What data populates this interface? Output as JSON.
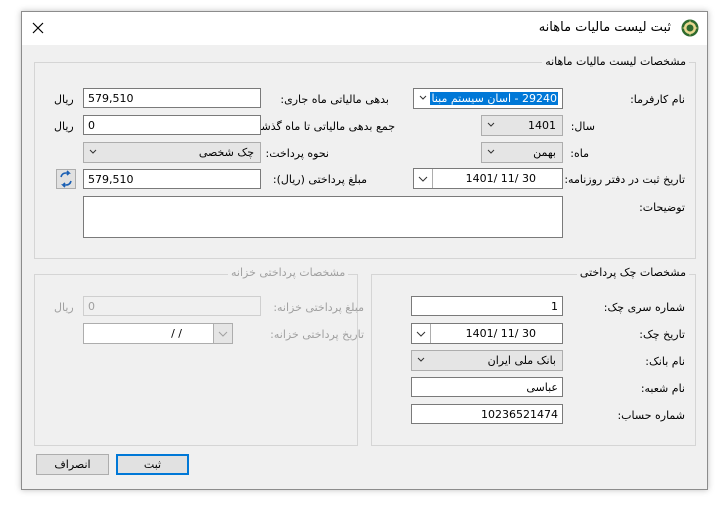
{
  "window": {
    "title": "ثبت لیست مالیات ماهانه",
    "close_glyph": "✕"
  },
  "section_monthly": {
    "legend": "مشخصات لیست مالیات ماهانه",
    "employer_label": "نام کارفرما:",
    "employer_value": "29240 - اسان سیستم مبنا",
    "year_label": "سال:",
    "year_value": "1401",
    "month_label": "ماه:",
    "month_value": "بهمن",
    "journal_date_label": "تاریخ ثبت در دفتر روزنامه:",
    "journal_date_value": "1401/ 11/ 30",
    "description_label": "توضیحات:",
    "current_debt_label": "بدهی مالیاتی ماه جاری:",
    "current_debt_value": "579,510",
    "past_debt_label": "جمع بدهی مالیاتی تا ماه گذشته:",
    "past_debt_value": "0",
    "payment_method_label": "نحوه پرداخت:",
    "payment_method_value": "چک شخصی",
    "paid_amount_label": "مبلغ پرداختی (ریال):",
    "paid_amount_value": "579,510",
    "currency_unit": "ریال"
  },
  "section_cheque": {
    "legend": "مشخصات چک پرداختی",
    "serial_label": "شماره سری چک:",
    "serial_value": "1",
    "date_label": "تاریخ چک:",
    "date_value": "1401/ 11/ 30",
    "bank_label": "نام بانک:",
    "bank_value": "بانک ملی ایران",
    "branch_label": "نام شعبه:",
    "branch_value": "عباسی",
    "account_label": "شماره حساب:",
    "account_value": "10236521474"
  },
  "section_treasury": {
    "legend": "مشخصات پرداختی خزانه",
    "amount_label": "مبلغ پرداختی خزانه:",
    "amount_value": "0",
    "currency_unit": "ریال",
    "date_label": "تاریخ پرداختی خزانه:",
    "date_value": "/      /"
  },
  "buttons": {
    "submit": "ثبت",
    "cancel": "انصراف"
  },
  "colors": {
    "selection": "#0078d7",
    "default_button_border": "#0078d7"
  }
}
